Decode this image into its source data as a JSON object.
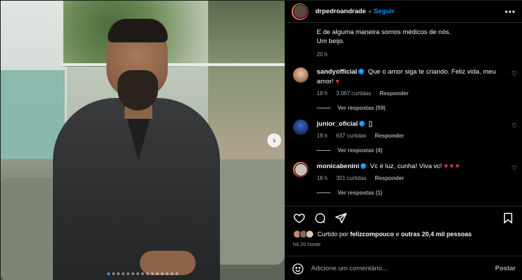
{
  "post": {
    "username": "drpedroandrade",
    "separator": "•",
    "follow_label": "Seguir",
    "more_label": "•••",
    "caption_line1": "E de alguma maneira somos médicos de nós.",
    "caption_line2": "Um beijo.",
    "caption_time": "20 h"
  },
  "carousel": {
    "dot_count": 15,
    "active_index": 0,
    "next_label": "›"
  },
  "comments": [
    {
      "user": "sandyofficial",
      "text": "Que o amor siga te criando. Feliz vida, meu amor!",
      "emoji": "♥",
      "time": "19 h",
      "likes": "3.067 curtidas",
      "reply": "Responder",
      "replies": "Ver respostas (59)"
    },
    {
      "user": "junior_oficial",
      "text": "[]",
      "emoji": "",
      "time": "19 h",
      "likes": "637 curtidas",
      "reply": "Responder",
      "replies": "Ver respostas (4)"
    },
    {
      "user": "monicabenini",
      "text": "Vc é luz, cunha! Viva vc!",
      "emoji": "♥ ♥ ♥",
      "time": "18 h",
      "likes": "301 curtidas",
      "reply": "Responder",
      "replies": "Ver respostas (1)"
    }
  ],
  "likes": {
    "prefix": "Curtido por",
    "user": "felizcompouco",
    "joiner": "e",
    "others": "outras 20,4 mil pessoas"
  },
  "time_ago": "há 20 horas",
  "add_comment": {
    "placeholder": "Adicione um comentário...",
    "post_label": "Postar"
  },
  "colors": {
    "accent": "#0095f6",
    "heart": "#ff3040",
    "background": "#000000"
  }
}
